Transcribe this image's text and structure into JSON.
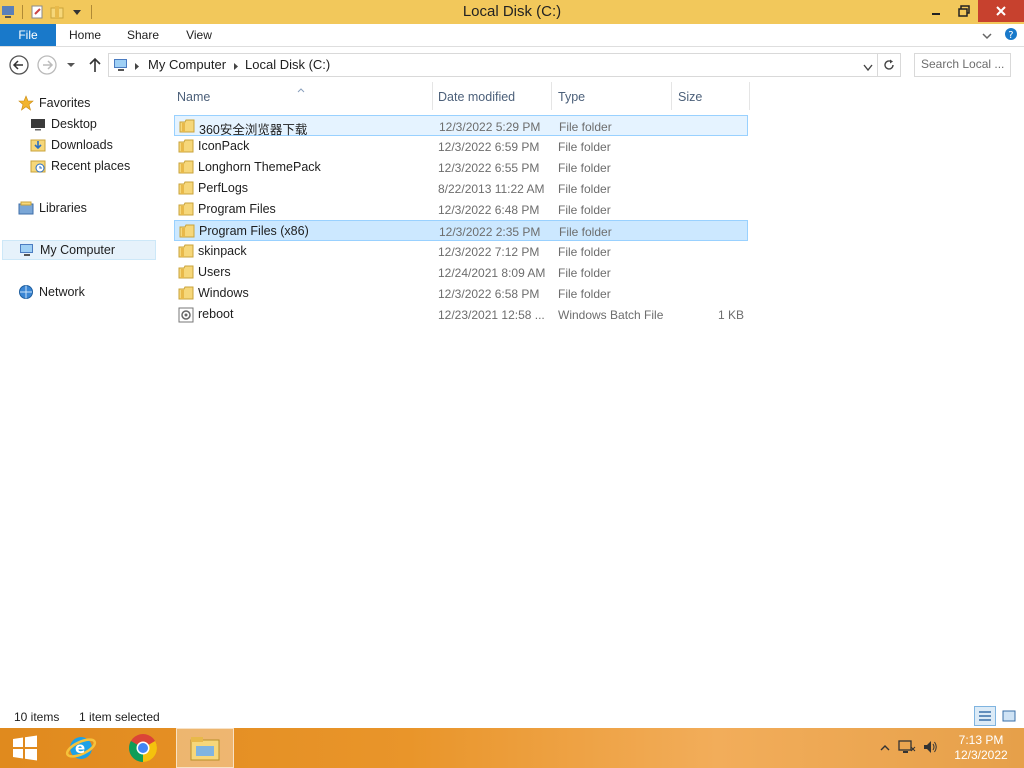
{
  "window": {
    "title": "Local Disk (C:)"
  },
  "ribbon": {
    "tabs": [
      "File",
      "Home",
      "Share",
      "View"
    ]
  },
  "address": {
    "crumbs": [
      "My Computer",
      "Local Disk (C:)"
    ]
  },
  "search": {
    "placeholder": "Search Local ..."
  },
  "nav": {
    "favorites": {
      "label": "Favorites",
      "items": [
        "Desktop",
        "Downloads",
        "Recent places"
      ]
    },
    "libraries": "Libraries",
    "computer": "My Computer",
    "network": "Network"
  },
  "columns": [
    "Name",
    "Date modified",
    "Type",
    "Size"
  ],
  "files": [
    {
      "name": "360安全浏览器下载",
      "date": "12/3/2022 5:29 PM",
      "type": "File folder",
      "size": "",
      "kind": "folder",
      "state": "hover"
    },
    {
      "name": "IconPack",
      "date": "12/3/2022 6:59 PM",
      "type": "File folder",
      "size": "",
      "kind": "folder",
      "state": ""
    },
    {
      "name": "Longhorn ThemePack",
      "date": "12/3/2022 6:55 PM",
      "type": "File folder",
      "size": "",
      "kind": "folder",
      "state": ""
    },
    {
      "name": "PerfLogs",
      "date": "8/22/2013 11:22 AM",
      "type": "File folder",
      "size": "",
      "kind": "folder",
      "state": ""
    },
    {
      "name": "Program Files",
      "date": "12/3/2022 6:48 PM",
      "type": "File folder",
      "size": "",
      "kind": "folder",
      "state": ""
    },
    {
      "name": "Program Files (x86)",
      "date": "12/3/2022 2:35 PM",
      "type": "File folder",
      "size": "",
      "kind": "folder",
      "state": "selected"
    },
    {
      "name": "skinpack",
      "date": "12/3/2022 7:12 PM",
      "type": "File folder",
      "size": "",
      "kind": "folder",
      "state": ""
    },
    {
      "name": "Users",
      "date": "12/24/2021 8:09 AM",
      "type": "File folder",
      "size": "",
      "kind": "folder",
      "state": ""
    },
    {
      "name": "Windows",
      "date": "12/3/2022 6:58 PM",
      "type": "File folder",
      "size": "",
      "kind": "folder",
      "state": ""
    },
    {
      "name": "reboot",
      "date": "12/23/2021 12:58 ...",
      "type": "Windows Batch File",
      "size": "1 KB",
      "kind": "batch-file",
      "state": ""
    }
  ],
  "status": {
    "count": "10 items",
    "selection": "1 item selected"
  },
  "taskbar": {
    "apps": [
      "start-button",
      "internet-explorer",
      "chrome",
      "file-explorer"
    ],
    "clock": {
      "time": "7:13 PM",
      "date": "12/3/2022"
    }
  },
  "colors": {
    "titlebar": "#f2c85b",
    "file_tab": "#1979ca",
    "selection": "#cce8ff",
    "taskbar": "#e9952a"
  }
}
